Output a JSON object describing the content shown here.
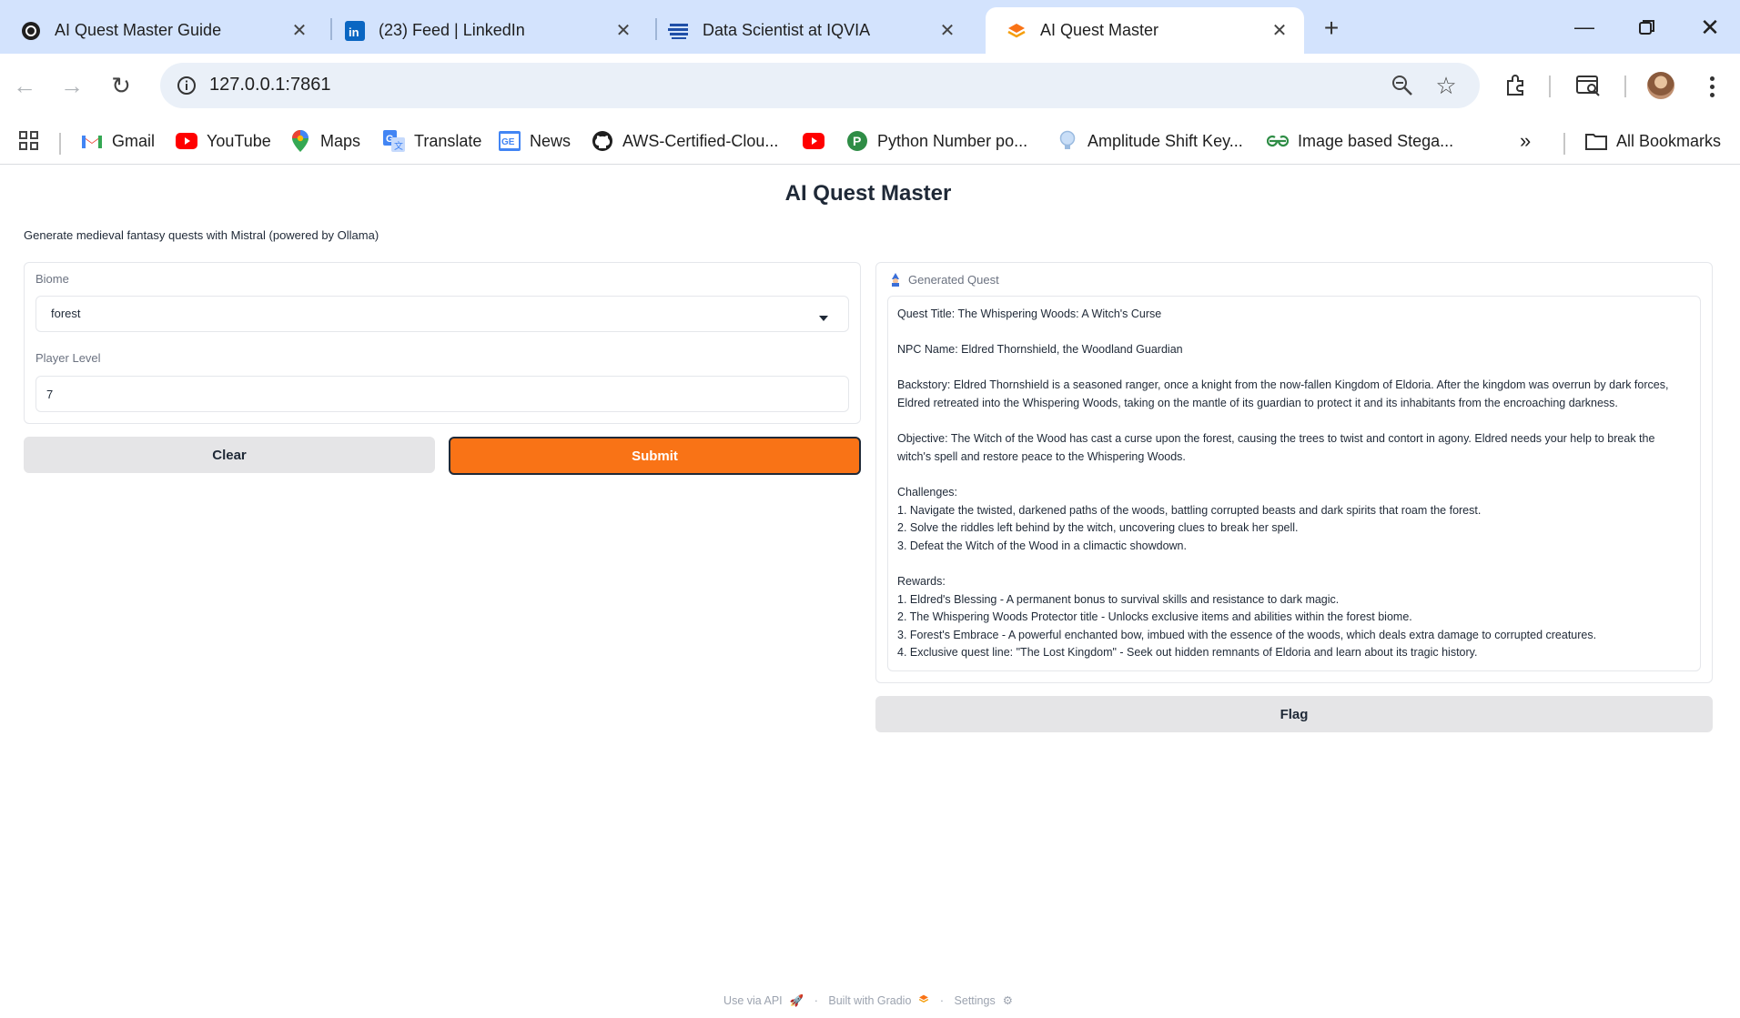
{
  "browser": {
    "tabs": [
      {
        "title": "AI Quest Master Guide",
        "icon": "openai-icon"
      },
      {
        "title": "(23) Feed | LinkedIn",
        "icon": "linkedin-icon"
      },
      {
        "title": "Data Scientist at IQVIA",
        "icon": "iqvia-icon"
      },
      {
        "title": "AI Quest Master",
        "icon": "gradio-icon",
        "active": true
      }
    ],
    "url": "127.0.0.1:7861",
    "bookmarks": [
      {
        "label": "Gmail",
        "icon": "gmail-icon"
      },
      {
        "label": "YouTube",
        "icon": "youtube-icon"
      },
      {
        "label": "Maps",
        "icon": "maps-icon"
      },
      {
        "label": "Translate",
        "icon": "translate-icon"
      },
      {
        "label": "News",
        "icon": "news-icon"
      },
      {
        "label": "AWS-Certified-Clou...",
        "icon": "github-icon"
      },
      {
        "label": "",
        "icon": "youtube-icon"
      },
      {
        "label": "Python Number po...",
        "icon": "python-icon"
      },
      {
        "label": "Amplitude Shift Key...",
        "icon": "bulb-icon"
      },
      {
        "label": "Image based Stega...",
        "icon": "geeks-icon"
      }
    ],
    "all_bookmarks_label": "All Bookmarks"
  },
  "app": {
    "title": "AI Quest Master",
    "description": "Generate medieval fantasy quests with Mistral (powered by Ollama)",
    "inputs": {
      "biome_label": "Biome",
      "biome_value": "forest",
      "level_label": "Player Level",
      "level_value": "7"
    },
    "buttons": {
      "clear": "Clear",
      "submit": "Submit",
      "flag": "Flag"
    },
    "output": {
      "label": "Generated Quest",
      "text": "Quest Title: The Whispering Woods: A Witch's Curse\n\nNPC Name: Eldred Thornshield, the Woodland Guardian\n\nBackstory: Eldred Thornshield is a seasoned ranger, once a knight from the now-fallen Kingdom of Eldoria. After the kingdom was overrun by dark forces, Eldred retreated into the Whispering Woods, taking on the mantle of its guardian to protect it and its inhabitants from the encroaching darkness.\n\nObjective: The Witch of the Wood has cast a curse upon the forest, causing the trees to twist and contort in agony. Eldred needs your help to break the witch's spell and restore peace to the Whispering Woods.\n\nChallenges:\n1. Navigate the twisted, darkened paths of the woods, battling corrupted beasts and dark spirits that roam the forest.\n2. Solve the riddles left behind by the witch, uncovering clues to break her spell.\n3. Defeat the Witch of the Wood in a climactic showdown.\n\nRewards:\n1. Eldred's Blessing - A permanent bonus to survival skills and resistance to dark magic.\n2. The Whispering Woods Protector title - Unlocks exclusive items and abilities within the forest biome.\n3. Forest's Embrace - A powerful enchanted bow, imbued with the essence of the woods, which deals extra damage to corrupted creatures.\n4. Exclusive quest line: \"The Lost Kingdom\" - Seek out hidden remnants of Eldoria and learn about its tragic history."
    },
    "footer": {
      "api": "Use via API",
      "built": "Built with Gradio",
      "settings": "Settings",
      "dot": "·"
    }
  },
  "colors": {
    "accent": "#f97316",
    "tabstrip": "#d3e3fd"
  }
}
